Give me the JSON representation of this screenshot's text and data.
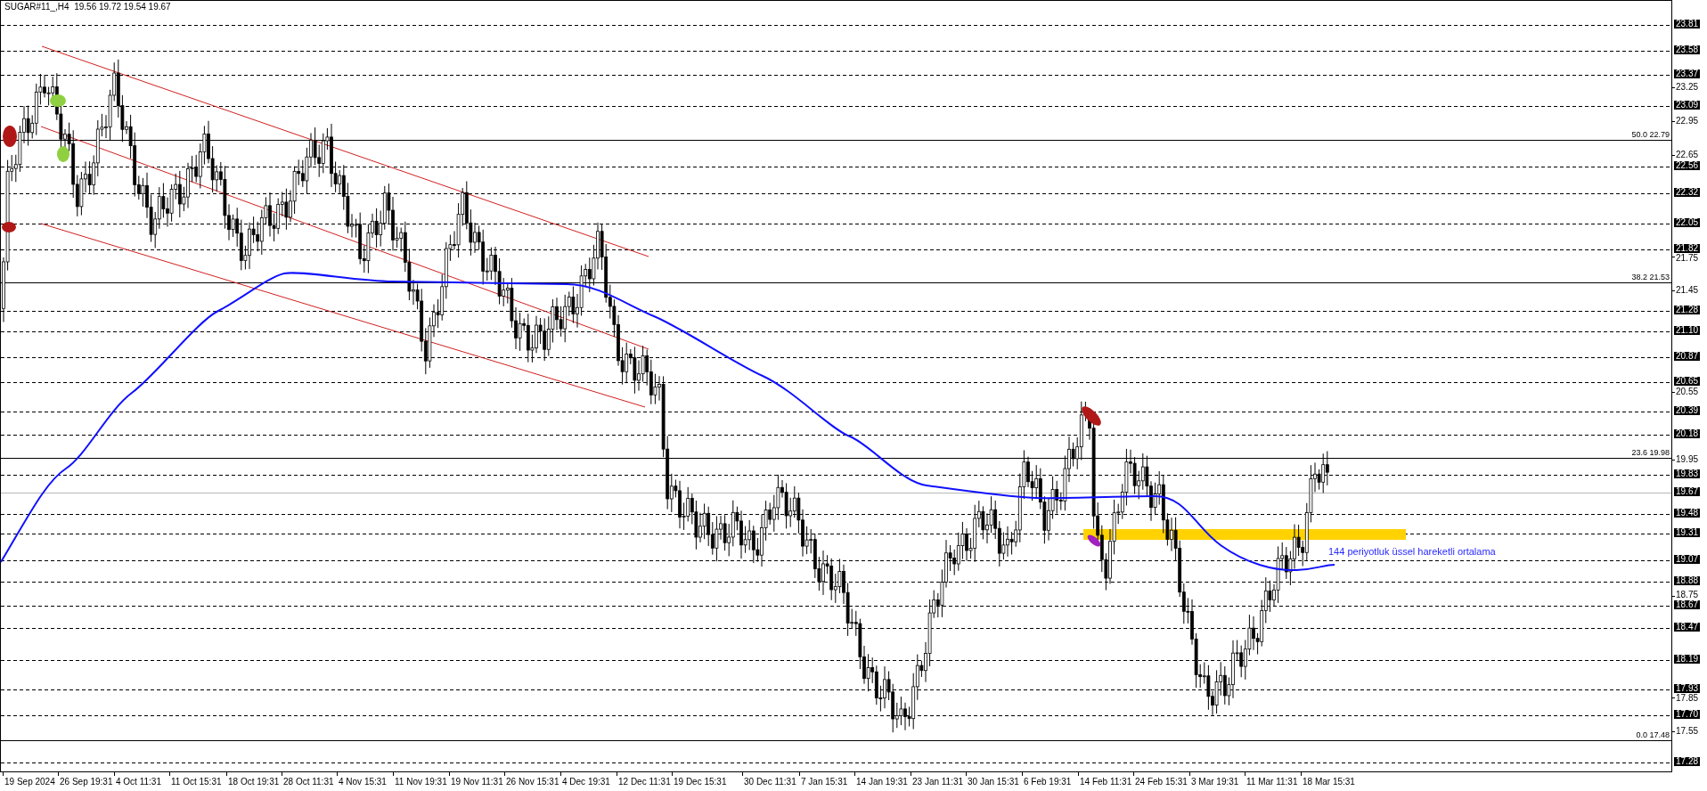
{
  "chart": {
    "header": "SUGAR#11_,H4  19.56 19.72 19.54 19.67",
    "annotation": "144 periyotluk üssel hareketli ortalama",
    "fibonacci_levels": [
      {
        "label": "50.0 22.79"
      },
      {
        "label": "38.2 21.53"
      },
      {
        "label": "23.6 19.98"
      },
      {
        "label": "0.0 17.48"
      }
    ],
    "price_axis": [
      {
        "label": "23.81",
        "kind": "level"
      },
      {
        "label": "23.58",
        "kind": "level"
      },
      {
        "label": "23.37",
        "kind": "level"
      },
      {
        "label": "23.25",
        "kind": "tick"
      },
      {
        "label": "23.09",
        "kind": "level"
      },
      {
        "label": "22.95",
        "kind": "tick"
      },
      {
        "label": "22.65",
        "kind": "tick"
      },
      {
        "label": "22.56",
        "kind": "level"
      },
      {
        "label": "22.32",
        "kind": "level"
      },
      {
        "label": "22.05",
        "kind": "level"
      },
      {
        "label": "21.82",
        "kind": "level"
      },
      {
        "label": "21.75",
        "kind": "tick"
      },
      {
        "label": "21.45",
        "kind": "tick"
      },
      {
        "label": "21.28",
        "kind": "level"
      },
      {
        "label": "21.10",
        "kind": "level"
      },
      {
        "label": "20.87",
        "kind": "level"
      },
      {
        "label": "20.65",
        "kind": "level"
      },
      {
        "label": "20.55",
        "kind": "tick"
      },
      {
        "label": "20.39",
        "kind": "level"
      },
      {
        "label": "20.18",
        "kind": "level"
      },
      {
        "label": "19.95",
        "kind": "tick"
      },
      {
        "label": "19.83",
        "kind": "level"
      },
      {
        "label": "19.67",
        "kind": "current"
      },
      {
        "label": "19.48",
        "kind": "level"
      },
      {
        "label": "19.31",
        "kind": "level"
      },
      {
        "label": "19.07",
        "kind": "level"
      },
      {
        "label": "18.88",
        "kind": "level"
      },
      {
        "label": "18.75",
        "kind": "tick"
      },
      {
        "label": "18.67",
        "kind": "level"
      },
      {
        "label": "18.47",
        "kind": "level"
      },
      {
        "label": "18.19",
        "kind": "level"
      },
      {
        "label": "17.93",
        "kind": "level"
      },
      {
        "label": "17.85",
        "kind": "tick"
      },
      {
        "label": "17.70",
        "kind": "level"
      },
      {
        "label": "17.55",
        "kind": "tick"
      },
      {
        "label": "17.28",
        "kind": "level"
      }
    ],
    "time_axis": [
      "19 Sep 2024",
      "26 Sep 19:31",
      "4 Oct 11:31",
      "11 Oct 15:31",
      "18 Oct 19:31",
      "28 Oct 11:31",
      "4 Nov 15:31",
      "11 Nov 19:31",
      "19 Nov 11:31",
      "26 Nov 15:31",
      "4 Dec 19:31",
      "12 Dec 11:31",
      "19 Dec 15:31",
      "30 Dec 11:31",
      "7 Jan 15:31",
      "14 Jan 19:31",
      "23 Jan 11:31",
      "30 Jan 15:31",
      "6 Feb 19:31",
      "14 Feb 11:31",
      "24 Feb 15:31",
      "3 Mar 19:31",
      "11 Mar 11:31",
      "18 Mar 15:31"
    ]
  }
}
